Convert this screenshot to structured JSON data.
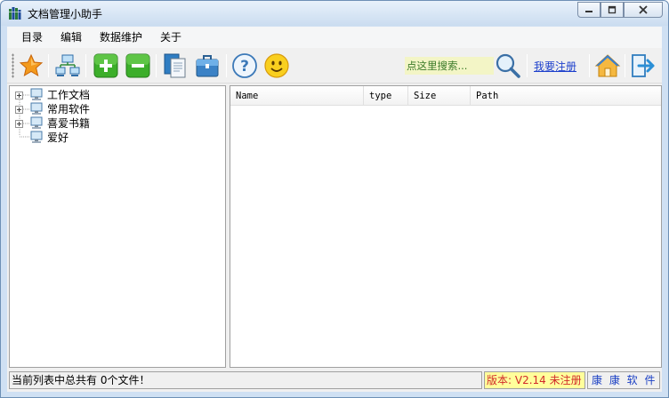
{
  "window": {
    "title": "文档管理小助手"
  },
  "menu": {
    "items": [
      "目录",
      "编辑",
      "数据维护",
      "关于"
    ]
  },
  "toolbar": {
    "icons": [
      "favorite-star-icon",
      "network-computers-icon",
      "add-icon",
      "remove-icon",
      "copy-documents-icon",
      "briefcase-icon",
      "help-icon",
      "smiley-icon",
      "search-icon",
      "home-icon",
      "exit-icon"
    ],
    "search_placeholder": "点这里搜索...",
    "register_label": "我要注册"
  },
  "tree": {
    "items": [
      {
        "label": "工作文档",
        "expandable": true
      },
      {
        "label": "常用软件",
        "expandable": true
      },
      {
        "label": "喜爱书籍",
        "expandable": true
      },
      {
        "label": "爱好",
        "expandable": false
      }
    ]
  },
  "file_list": {
    "columns": [
      "Name",
      "type",
      "Size",
      "Path"
    ],
    "rows": []
  },
  "status": {
    "message": "当前列表中总共有 0个文件！",
    "version": "版本: V2.14 未注册",
    "brand": "康 康 软 件"
  },
  "colors": {
    "search_bg": "#f3f5c6",
    "version_bg": "#ffff9b",
    "version_text": "#d12a2a",
    "brand_text": "#1a3fc4"
  }
}
